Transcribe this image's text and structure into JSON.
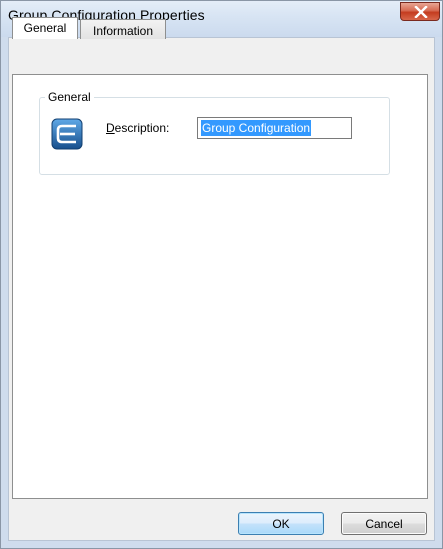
{
  "window": {
    "title": "Group Configuration Properties",
    "close_icon": "close-x-icon"
  },
  "tabs": [
    {
      "label": "General",
      "selected": true
    },
    {
      "label": "Information",
      "selected": false
    }
  ],
  "general_group": {
    "legend": "General",
    "icon": "group-configuration-icon",
    "description_label_accel": "D",
    "description_label_rest": "escription:",
    "description_value": "Group Configuration"
  },
  "buttons": {
    "ok_label": "OK",
    "cancel_label": "Cancel"
  },
  "colors": {
    "titlebar": "#d7e4f3",
    "close_button": "#c43c1f",
    "selection": "#3399ff",
    "ok_border": "#3c7fb1",
    "icon_blue": "#1f6fb5"
  }
}
